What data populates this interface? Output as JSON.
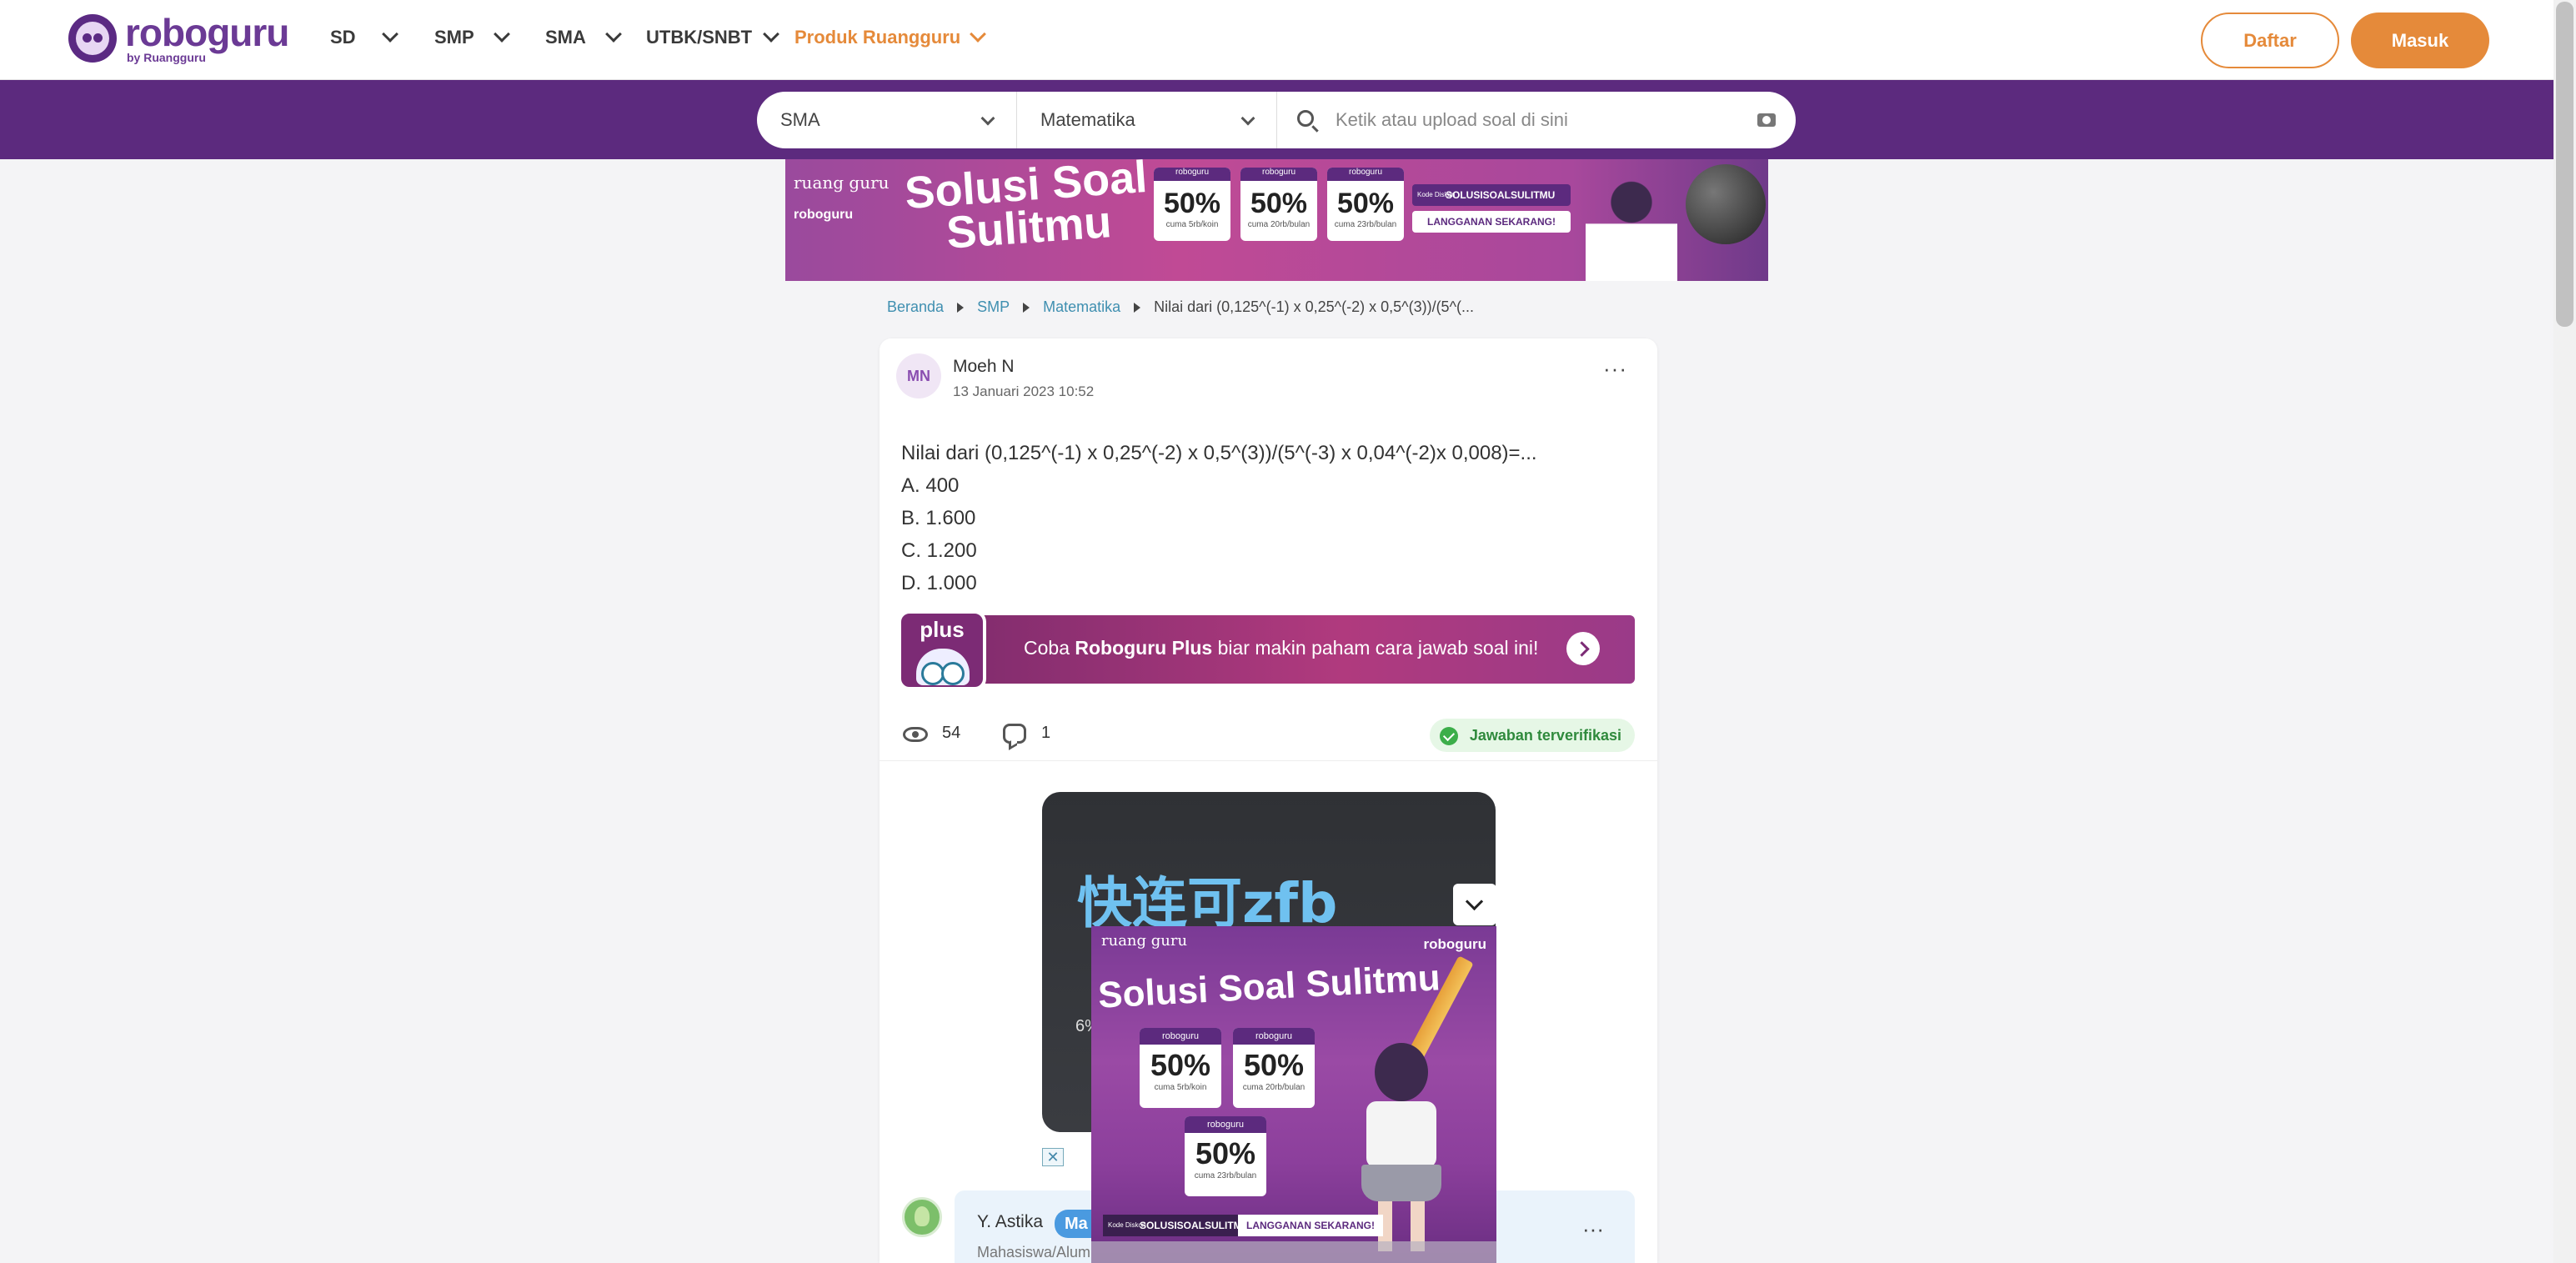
{
  "header": {
    "logo_name": "roboguru",
    "logo_sub": "by Ruangguru",
    "nav": [
      {
        "label": "SD"
      },
      {
        "label": "SMP"
      },
      {
        "label": "SMA"
      },
      {
        "label": "UTBK/SNBT"
      },
      {
        "label": "Produk Ruangguru",
        "accent": "#e58a3a"
      }
    ],
    "daftar_label": "Daftar",
    "masuk_label": "Masuk"
  },
  "search": {
    "level": "SMA",
    "subject": "Matematika",
    "placeholder": "Ketik atau upload soal di sini"
  },
  "top_banner": {
    "brand": "ruang guru",
    "brand2": "roboguru",
    "title_line1": "Solusi Soal",
    "title_line2": "Sulitmu",
    "offers": [
      {
        "head": "roboguru",
        "pct": "50%",
        "note": "cuma 5rb/koin"
      },
      {
        "head": "roboguru",
        "pct": "50%",
        "note": "cuma 20rb/bulan"
      },
      {
        "head": "roboguru",
        "pct": "50%",
        "note": "cuma 23rb/bulan"
      }
    ],
    "kode_label": "Kode Diskon",
    "kode": "SOLUSISOALSULITMU",
    "cta": "LANGGANAN SEKARANG!"
  },
  "breadcrumb": {
    "items": [
      "Beranda",
      "SMP",
      "Matematika"
    ],
    "current": "Nilai dari (0,125^(-1) x 0,25^(-2) x 0,5^(3))/(5^(..."
  },
  "question": {
    "avatar_initials": "MN",
    "author": "Moeh N",
    "date": "13 Januari 2023 10:52",
    "more": "···",
    "text": "Nilai dari (0,125^(-1) x 0,25^(-2) x 0,5^(3))/(5^(-3) x 0,04^(-2)x 0,008)=...",
    "options": [
      "A. 400",
      "B. 1.600",
      "C. 1.200",
      "D. 1.000"
    ],
    "plus_badge": "plus",
    "plus_pre": "Coba ",
    "plus_bold": "Roboguru Plus",
    "plus_post": " biar makin paham cara jawab soal ini!",
    "views": "54",
    "comments": "1",
    "verified": "Jawaban terverifikasi"
  },
  "ad": {
    "headline": "快连可zfb",
    "partial": "6%",
    "x_label": "✕"
  },
  "answer": {
    "author": "Y. Astika",
    "tag": "Ma",
    "subtitle": "Mahasiswa/Alum",
    "more": "···"
  },
  "floating_banner": {
    "brand": "ruang guru",
    "brand2": "roboguru",
    "title": "Solusi Soal Sulitmu",
    "offers": [
      {
        "head": "roboguru",
        "pct": "50%",
        "note": "cuma 5rb/koin"
      },
      {
        "head": "roboguru",
        "pct": "50%",
        "note": "cuma 20rb/bulan"
      },
      {
        "head": "roboguru",
        "pct": "50%",
        "note": "cuma 23rb/bulan"
      }
    ],
    "kode_label": "Kode Diskon",
    "kode": "SOLUSISOALSULITMU",
    "cta": "LANGGANAN SEKARANG!"
  },
  "colors": {
    "brand_purple": "#5c2a7e",
    "accent_orange": "#e58a3a",
    "verified_green": "#3cae4a",
    "link_blue": "#3f8fb0"
  }
}
